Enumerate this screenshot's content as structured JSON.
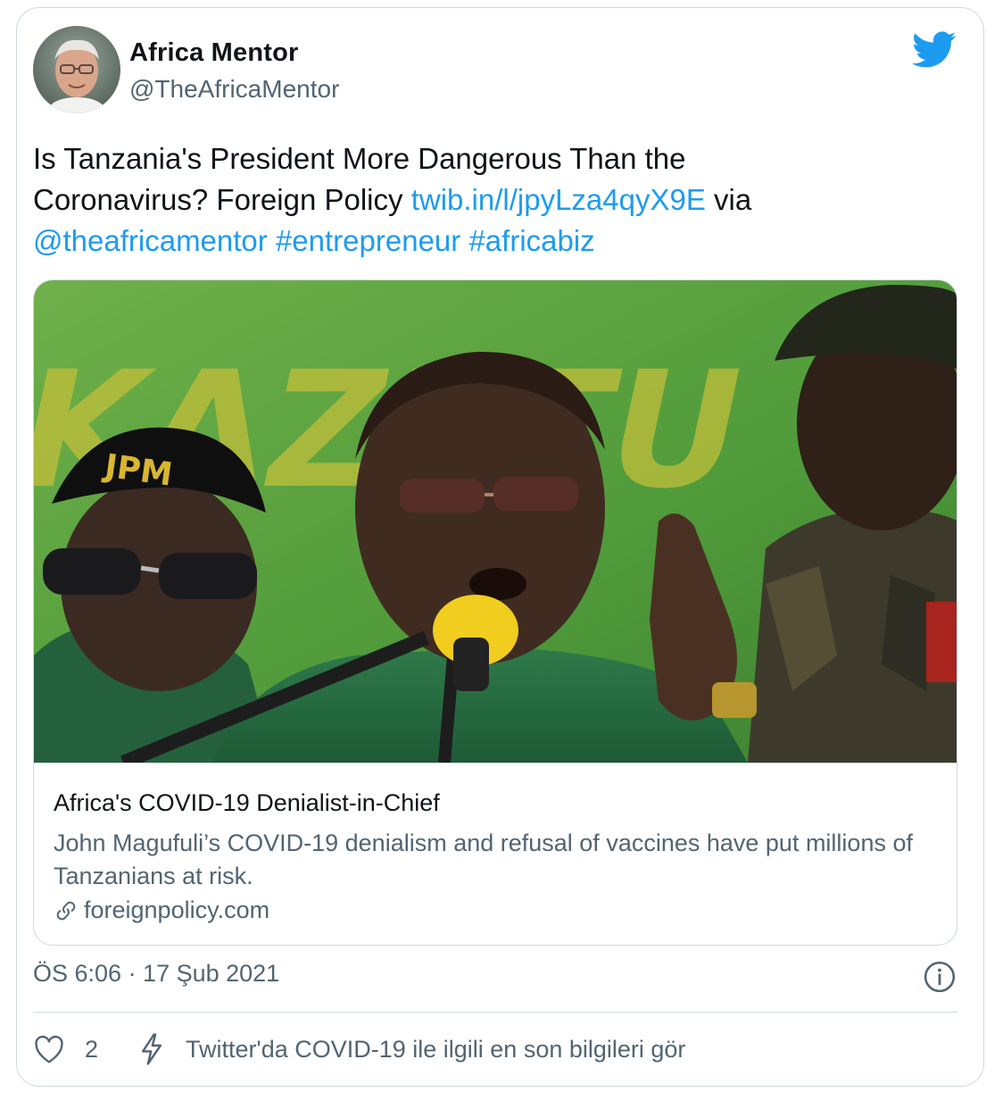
{
  "author": {
    "name": "Africa Mentor",
    "handle": "@TheAfricaMentor"
  },
  "tweet": {
    "text_line1": "Is Tanzania's President More Dangerous Than the",
    "text_line2_prefix": "Coronavirus?  Foreign Policy ",
    "link_url": "twib.in/l/jpyLza4qyX9E",
    "via": " via",
    "mention": "@theafricamentor",
    "hashtag1": "#entrepreneur",
    "hashtag2": "#africabiz"
  },
  "card": {
    "image_banner_text": "KAZI TU",
    "cap_text": "JPM",
    "title": "Africa's COVID-19 Denialist-in-Chief",
    "description": "John Magufuli’s COVID-19 denialism and refusal of vaccines have put millions of Tanzanians at risk.",
    "domain": "foreignpolicy.com"
  },
  "timestamp": "ÖS 6:06 · 17 Şub 2021",
  "footer": {
    "like_count": "2",
    "covid_label": "Twitter'da COVID-19 ile ilgili en son bilgileri gör"
  },
  "colors": {
    "brand_blue": "#1d9bf0",
    "secondary_text": "#536471",
    "border": "#cfd9de"
  },
  "icons": [
    "twitter-bird-icon",
    "link-icon",
    "info-icon",
    "heart-icon",
    "lightning-icon"
  ]
}
